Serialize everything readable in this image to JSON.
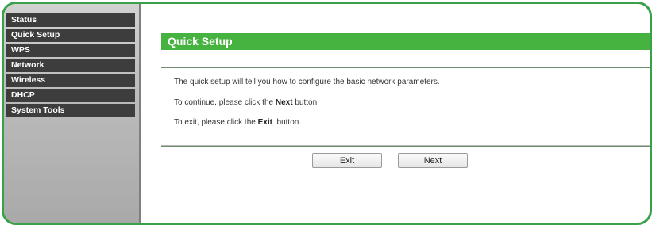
{
  "sidebar": {
    "items": [
      {
        "label": "Status"
      },
      {
        "label": "Quick Setup"
      },
      {
        "label": "WPS"
      },
      {
        "label": "Network"
      },
      {
        "label": "Wireless"
      },
      {
        "label": "DHCP"
      },
      {
        "label": "System Tools"
      }
    ]
  },
  "main": {
    "title": "Quick Setup",
    "line1": "The quick setup will tell you how to configure the basic network parameters.",
    "line2_prefix": "To continue, please click the ",
    "line2_bold": "Next",
    "line2_suffix": " button.",
    "line3_prefix": "To exit, please click the ",
    "line3_bold": "Exit",
    "line3_suffix": "  button."
  },
  "buttons": {
    "exit_label": "Exit",
    "next_label": "Next"
  },
  "colors": {
    "accent": "#46b23f",
    "frame_border": "#3aa04a",
    "nav_bg": "#3d3d3d"
  }
}
